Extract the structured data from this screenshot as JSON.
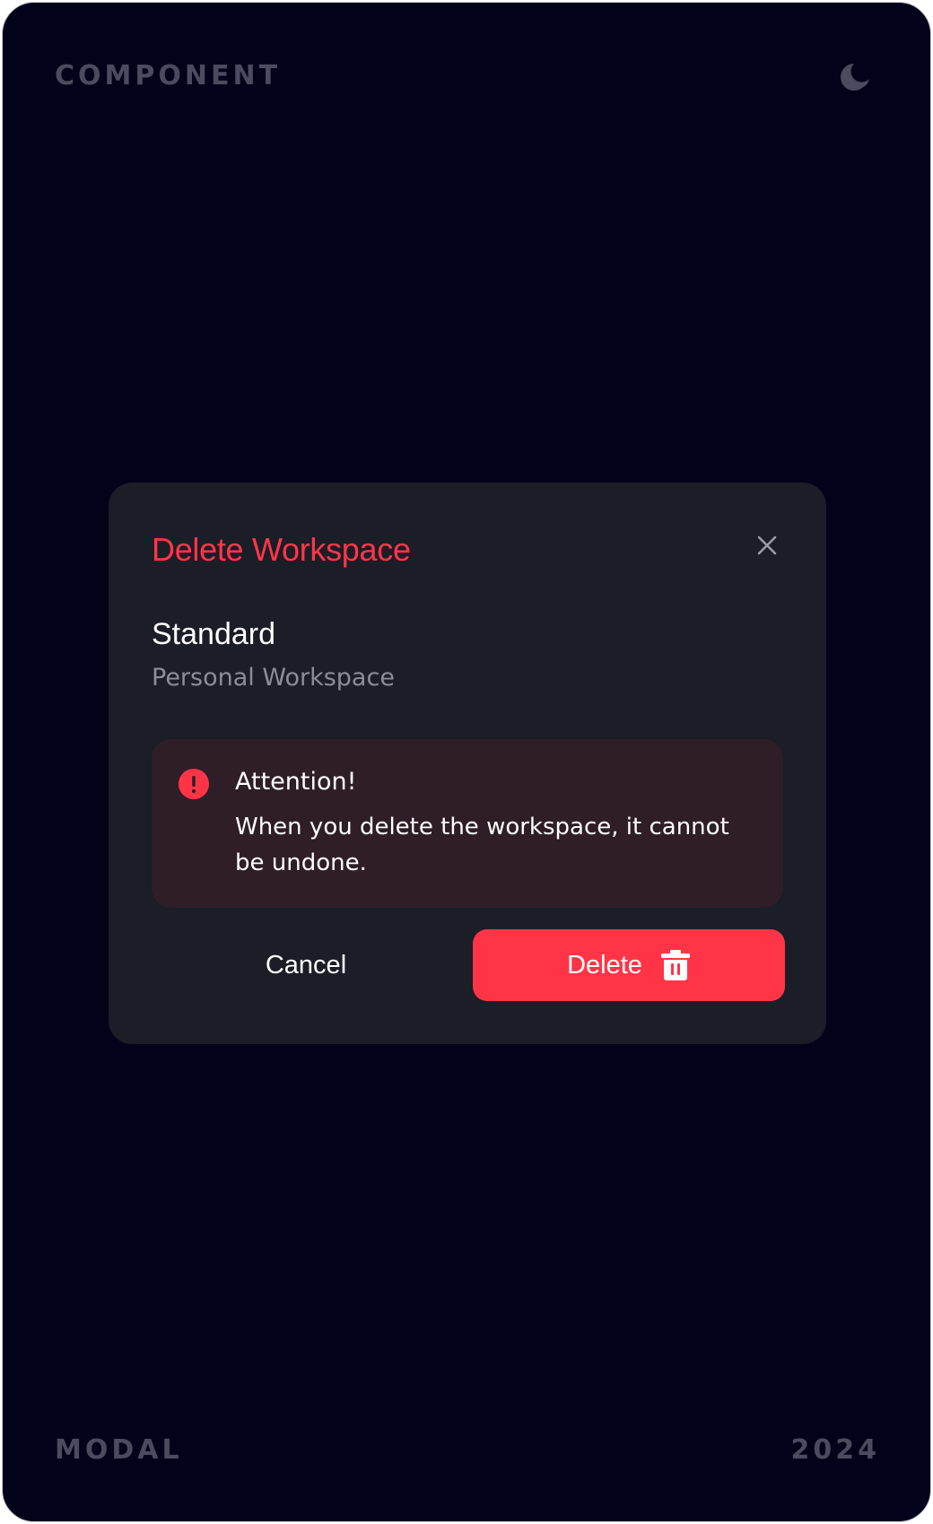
{
  "page": {
    "top_label": "COMPONENT",
    "bottom_left_label": "MODAL",
    "bottom_right_label": "2024",
    "theme_icon": "moon-icon"
  },
  "modal": {
    "title": "Delete Workspace",
    "close_icon": "close-icon",
    "workspace_name": "Standard",
    "workspace_type": "Personal Workspace",
    "alert": {
      "icon": "alert-circle-icon",
      "title": "Attention!",
      "message": "When you delete the workspace, it cannot be undone."
    },
    "cancel_label": "Cancel",
    "delete_label": "Delete",
    "delete_icon": "trash-icon"
  },
  "colors": {
    "background": "#02031a",
    "modal": "#1b1d27",
    "accent": "#ff3547",
    "alert_bg": "#2f1e28"
  }
}
